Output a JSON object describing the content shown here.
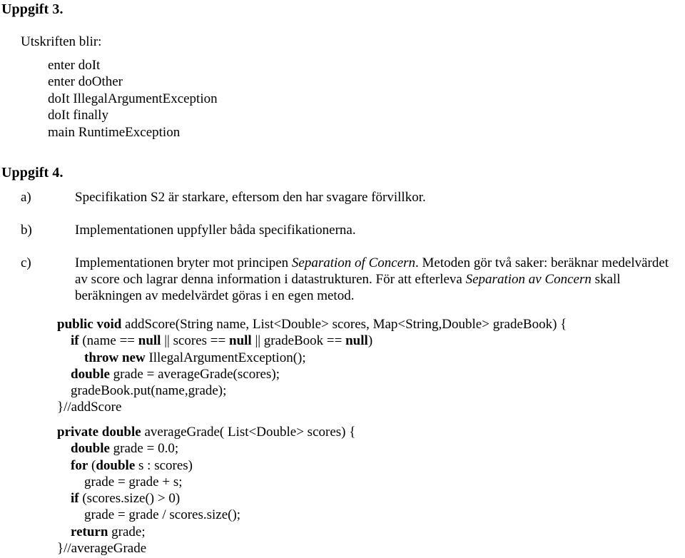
{
  "document": {
    "language": "sv",
    "background_color": "#ffffff",
    "text_color": "#000000"
  },
  "sections": [
    {
      "heading": "Uppgift 3.",
      "intro": "Utskriften blir:",
      "output_lines": [
        "enter doIt",
        "enter doOther",
        "doIt IllegalArgumentException",
        "doIt finally",
        "main RuntimeException"
      ]
    },
    {
      "heading": "Uppgift 4.",
      "items": [
        {
          "marker": "a)",
          "text": "Specifikation S2 är starkare, eftersom den har svagare förvillkor."
        },
        {
          "marker": "b)",
          "text": "Implementationen uppfyller båda specifikationerna."
        },
        {
          "marker": "c)",
          "text_part_1": "Implementationen bryter mot principen ",
          "italic_1": "Separation of Concern",
          "text_part_2": ". Metoden gör två saker: beräknar medelvärdet av score och lagrar denna information i datastrukturen. För att efterleva ",
          "italic_2": "Separation av Concern",
          "text_part_3": " skall beräkningen av medelvärdet göras i en egen metod."
        }
      ]
    }
  ],
  "code": {
    "addScore": {
      "lines": [
        [
          {
            "t": "public void",
            "b": true
          },
          {
            "t": " addScore(String name, List<Double> scores, Map<String,Double> gradeBook) {",
            "b": false
          }
        ],
        [
          {
            "t": "    ",
            "b": false
          },
          {
            "t": "if",
            "b": true
          },
          {
            "t": " (name == ",
            "b": false
          },
          {
            "t": "null",
            "b": true
          },
          {
            "t": " || scores == ",
            "b": false
          },
          {
            "t": "null",
            "b": true
          },
          {
            "t": " || gradeBook == ",
            "b": false
          },
          {
            "t": "null",
            "b": true
          },
          {
            "t": ")",
            "b": false
          }
        ],
        [
          {
            "t": "        ",
            "b": false
          },
          {
            "t": "throw new",
            "b": true
          },
          {
            "t": " IllegalArgumentException();",
            "b": false
          }
        ],
        [
          {
            "t": "    ",
            "b": false
          },
          {
            "t": "double",
            "b": true
          },
          {
            "t": " grade = averageGrade(scores);",
            "b": false
          }
        ],
        [
          {
            "t": "    gradeBook.put(name,grade);",
            "b": false
          }
        ],
        [
          {
            "t": "}//addScore",
            "b": false
          }
        ]
      ]
    },
    "averageGrade": {
      "lines": [
        [
          {
            "t": "private double",
            "b": true
          },
          {
            "t": " averageGrade( List<Double> scores) {",
            "b": false
          }
        ],
        [
          {
            "t": "    ",
            "b": false
          },
          {
            "t": "double",
            "b": true
          },
          {
            "t": " grade = 0.0;",
            "b": false
          }
        ],
        [
          {
            "t": "    ",
            "b": false
          },
          {
            "t": "for",
            "b": true
          },
          {
            "t": " (",
            "b": false
          },
          {
            "t": "double",
            "b": true
          },
          {
            "t": " s : scores)",
            "b": false
          }
        ],
        [
          {
            "t": "        grade = grade + s;",
            "b": false
          }
        ],
        [
          {
            "t": "    ",
            "b": false
          },
          {
            "t": "if",
            "b": true
          },
          {
            "t": " (scores.size() > 0)",
            "b": false
          }
        ],
        [
          {
            "t": "        grade = grade / scores.size();",
            "b": false
          }
        ],
        [
          {
            "t": "    ",
            "b": false
          },
          {
            "t": "return",
            "b": true
          },
          {
            "t": " grade;",
            "b": false
          }
        ],
        [
          {
            "t": "}//averageGrade",
            "b": false
          }
        ]
      ]
    }
  }
}
